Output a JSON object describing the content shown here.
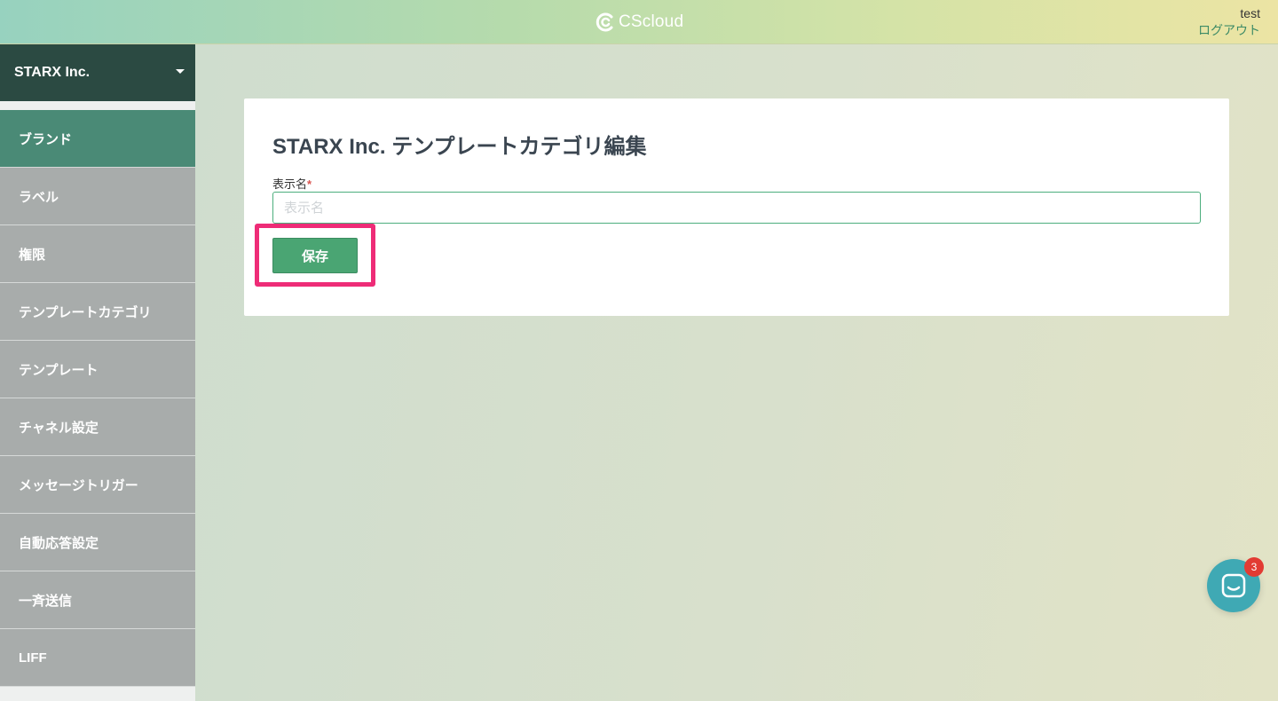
{
  "header": {
    "logo_text": "CScloud",
    "user_name": "test",
    "logout_label": "ログアウト"
  },
  "sidebar": {
    "org_name": "STARX Inc.",
    "items": [
      {
        "label": "ブランド",
        "active": true
      },
      {
        "label": "ラベル",
        "active": false
      },
      {
        "label": "権限",
        "active": false
      },
      {
        "label": "テンプレートカテゴリ",
        "active": false
      },
      {
        "label": "テンプレート",
        "active": false
      },
      {
        "label": "チャネル設定",
        "active": false
      },
      {
        "label": "メッセージトリガー",
        "active": false
      },
      {
        "label": "自動応答設定",
        "active": false
      },
      {
        "label": "一斉送信",
        "active": false
      },
      {
        "label": "LIFF",
        "active": false
      }
    ]
  },
  "main": {
    "title": "STARX Inc. テンプレートカテゴリ編集",
    "field_label": "表示名",
    "required_mark": "*",
    "input_value": "",
    "input_placeholder": "表示名",
    "save_label": "保存"
  },
  "chat_widget": {
    "badge_count": "3"
  },
  "colors": {
    "accent": "#4aa573",
    "sidebar_active": "#4a8a76",
    "sidebar_item": "#a8acab",
    "org_header": "#2b4a42",
    "highlight": "#ee2c77",
    "chat": "#3fa9b4",
    "badge": "#e23b33"
  }
}
